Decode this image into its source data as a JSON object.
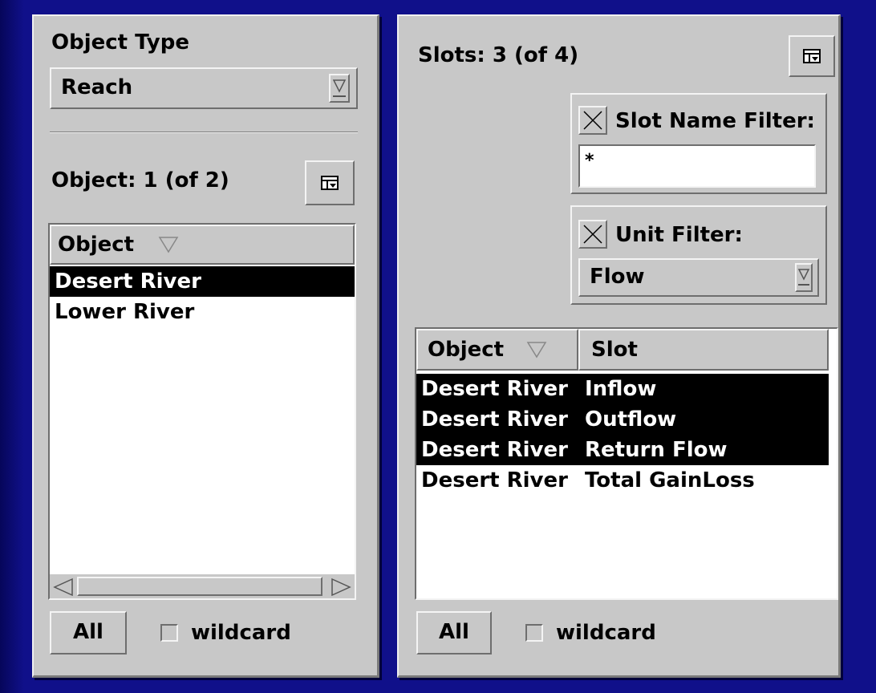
{
  "object_type": {
    "heading": "Object Type",
    "selected": "Reach"
  },
  "object_list": {
    "count_label": "Object: 1 (of 2)",
    "column_header": "Object",
    "items": [
      {
        "name": "Desert River",
        "selected": true
      },
      {
        "name": "Lower River",
        "selected": false
      }
    ],
    "all_button": "All",
    "wildcard_label": "wildcard"
  },
  "slots": {
    "count_label": "Slots: 3 (of 4)",
    "name_filter": {
      "label": "Slot Name Filter:",
      "value": "*"
    },
    "unit_filter": {
      "label": "Unit Filter:",
      "selected": "Flow"
    },
    "columns": [
      "Object",
      "Slot"
    ],
    "rows": [
      {
        "object": "Desert River",
        "slot": "Inflow",
        "selected": true
      },
      {
        "object": "Desert River",
        "slot": "Outflow",
        "selected": true
      },
      {
        "object": "Desert River",
        "slot": "Return Flow",
        "selected": true
      },
      {
        "object": "Desert River",
        "slot": "Total GainLoss",
        "selected": false
      }
    ],
    "all_button": "All",
    "wildcard_label": "wildcard"
  },
  "colors": {
    "background": "#10108a",
    "panel": "#c8c8c8",
    "selection": "#000000"
  }
}
